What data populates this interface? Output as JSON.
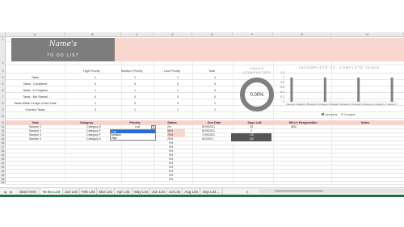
{
  "columns": [
    "A",
    "B",
    "C",
    "D",
    "E",
    "F",
    "G",
    "H"
  ],
  "rows": [
    "1",
    "2",
    "3",
    "4",
    "5",
    "6",
    "7",
    "8",
    "9",
    "10",
    "11",
    "12",
    "13",
    "14",
    "15",
    "16",
    "17",
    "18",
    "19",
    "20",
    "21",
    "22",
    "23",
    "24",
    "25",
    "26",
    "27",
    "28",
    "29",
    "30",
    "31",
    "32"
  ],
  "banner": {
    "name": "Name's",
    "subtitle": "TO DO LIST"
  },
  "summary": {
    "headers": [
      "High Priority",
      "Medium Priority",
      "Low Priority",
      "Total"
    ],
    "rows": [
      {
        "label": "Tasks",
        "values": [
          "1",
          "1",
          "1",
          "4"
        ]
      },
      {
        "label": "Tasks - Completed",
        "values": [
          "0",
          "0",
          "0",
          "0"
        ]
      },
      {
        "label": "Tasks - In Progress",
        "values": [
          "1",
          "1",
          "1",
          "3"
        ]
      },
      {
        "label": "Tasks - Not Started",
        "values": [
          "0",
          "0",
          "0",
          "0"
        ]
      },
      {
        "label": "Tasks Within 3 Days of Due Date",
        "values": [
          "1",
          "0",
          "0",
          "1"
        ]
      },
      {
        "label": "Overdue Tasks",
        "values": [
          "0",
          "1",
          "1",
          "2"
        ]
      }
    ]
  },
  "donut": {
    "title_line1": "TASKS",
    "title_line2": "COMPLETED",
    "value": "0.00%",
    "fraction": 0
  },
  "bar_chart_title": "INCOMPLETE VS. COMPLETE TASKS",
  "chart_data": {
    "type": "bar",
    "title": "INCOMPLETE VS. COMPLETE TASKS",
    "categories": [
      "Category A",
      "Category B",
      "Category C",
      "Category D",
      "Category E",
      "Category F",
      "Category G",
      "Category H",
      "Category I",
      "Category J"
    ],
    "series": [
      {
        "name": "Incomplete",
        "values": [
          1,
          0,
          0,
          1,
          0,
          0,
          1,
          0,
          0,
          1
        ]
      },
      {
        "name": "Complete",
        "values": [
          0,
          0,
          0,
          0,
          0,
          0,
          0,
          0,
          0,
          0
        ]
      }
    ],
    "ylim": [
      0,
      1.2
    ],
    "yticks": [
      "0",
      "0.2",
      "0.4",
      "0.6",
      "0.8",
      "1",
      "1.2"
    ],
    "legend": "bottom",
    "colors": {
      "Incomplete": "#7f7f7f",
      "Complete": "#f2c4b9"
    }
  },
  "task_table": {
    "headers": [
      "Task",
      "Category",
      "Priority",
      "Status",
      "Due Date",
      "Days Left",
      "Who's Responsible",
      "Notes"
    ],
    "rows": [
      {
        "task": "Sample 1",
        "category": "Category D",
        "priority": "Low",
        "status": "0%",
        "due": "8/19/2021",
        "days": "33",
        "who": "ABC",
        "notes": ""
      },
      {
        "task": "Sample 2",
        "category": "Category F",
        "priority": "",
        "status": "50%",
        "due": "8/29/2021",
        "days": "2",
        "who": "",
        "notes": ""
      },
      {
        "task": "Sample 3",
        "category": "Category F",
        "priority": "",
        "status": "75%",
        "due": "7/29/2021",
        "days": "-25",
        "who": "",
        "notes": ""
      },
      {
        "task": "Sample 4",
        "category": "Category A",
        "priority": "Medium",
        "status": "25%",
        "due": "6/1/2021",
        "days": "-83",
        "who": "",
        "notes": ""
      }
    ],
    "empty_status": "0%"
  },
  "priority_dropdown": {
    "options": [
      "Low",
      "Medium",
      "High"
    ],
    "selected": "Low"
  },
  "tabs": [
    "Start Here",
    "To Do List",
    "Jan List",
    "Feb List",
    "Mar List",
    "Apr List",
    "May List",
    "Jun List",
    "Jul List",
    "Aug List",
    "Sep List ..."
  ],
  "active_tab": "To Do List"
}
